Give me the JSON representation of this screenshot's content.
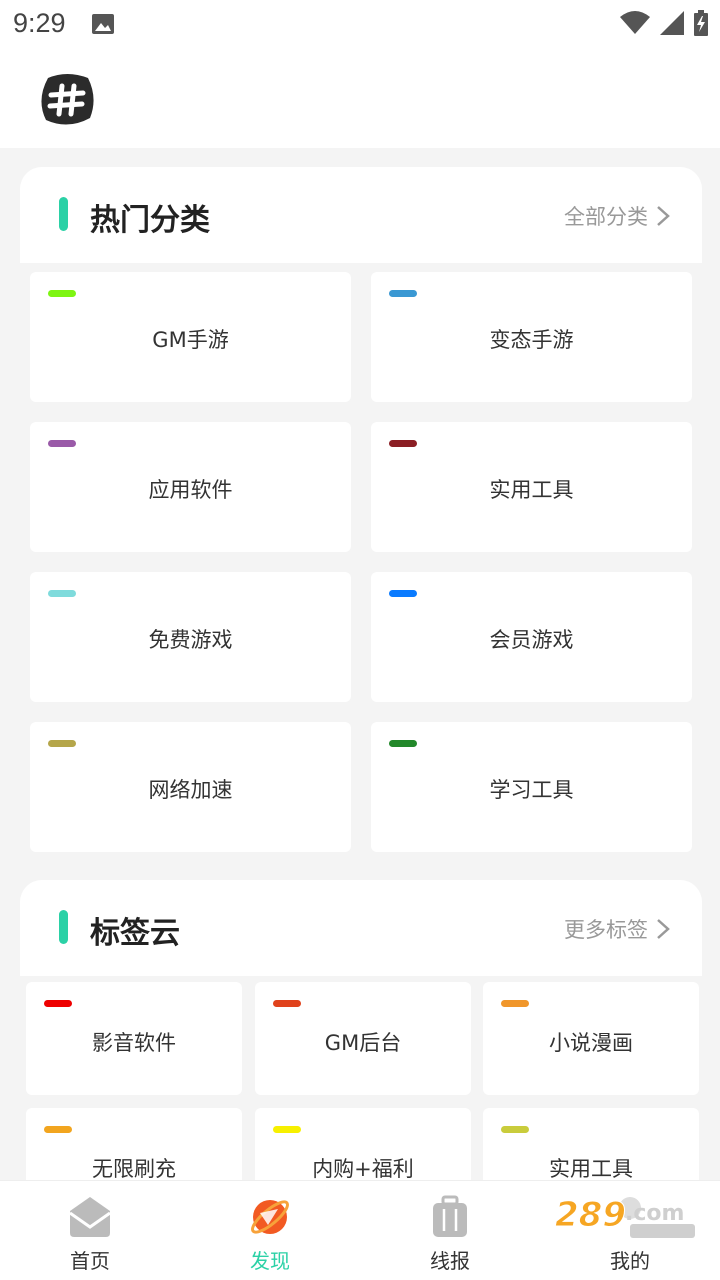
{
  "status": {
    "time": "9:29"
  },
  "hot": {
    "title": "热门分类",
    "more": "全部分类",
    "items": [
      {
        "label": "GM手游",
        "color": "#7ef512"
      },
      {
        "label": "变态手游",
        "color": "#3a98d3"
      },
      {
        "label": "应用软件",
        "color": "#9a5aa8"
      },
      {
        "label": "实用工具",
        "color": "#8b1e24"
      },
      {
        "label": "免费游戏",
        "color": "#7fdbdc"
      },
      {
        "label": "会员游戏",
        "color": "#0a7bff"
      },
      {
        "label": "网络加速",
        "color": "#b5a64a"
      },
      {
        "label": "学习工具",
        "color": "#22882a"
      }
    ]
  },
  "tags": {
    "title": "标签云",
    "more": "更多标签",
    "items": [
      {
        "label": "影音软件",
        "color": "#ee0000"
      },
      {
        "label": "GM后台",
        "color": "#e0421c"
      },
      {
        "label": "小说漫画",
        "color": "#f0962a"
      },
      {
        "label": "无限刷充",
        "color": "#f2a51f"
      },
      {
        "label": "内购+福利",
        "color": "#f7f000"
      },
      {
        "label": "实用工具",
        "color": "#c9cc3c"
      }
    ]
  },
  "nav": {
    "items": [
      {
        "label": "首页",
        "icon": "home-icon"
      },
      {
        "label": "发现",
        "icon": "planet-icon"
      },
      {
        "label": "线报",
        "icon": "suitcase-icon"
      },
      {
        "label": "我的",
        "icon": "user-icon"
      }
    ],
    "active_color": "#2bd1a6"
  }
}
